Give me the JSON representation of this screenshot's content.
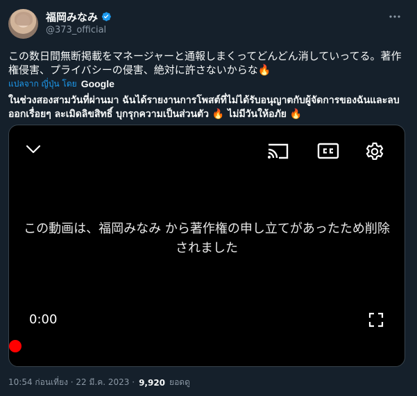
{
  "author": {
    "display_name": "福岡みなみ",
    "handle": "@373_official"
  },
  "tweet": {
    "text": "この数日間無断掲載をマネージャーと通報しまくってどんどん消していってる。著作権侵害、プライバシーの侵害、絶対に許さないからな🔥",
    "translate_label": "แปลจาก ญี่ปุ่น โดย",
    "translate_provider": "Google",
    "translated_text": "ในช่วงสองสามวันที่ผ่านมา ฉันได้รายงานการโพสต์ที่ไม่ได้รับอนุญาตกับผู้จัดการของฉันและลบออกเรื่อยๆ ละเมิดลิขสิทธิ์ บุกรุกความเป็นส่วนตัว 🔥 ไม่มีวันให้อภัย 🔥"
  },
  "video": {
    "removed_message": "この動画は、福岡みなみ から著作権の申し立てがあったため削除されました",
    "current_time": "0:00",
    "progress": 0
  },
  "meta": {
    "timestamp": "10:54 ก่อนเที่ยง · 22 มี.ค. 2023 ·",
    "views_count": "9,920",
    "views_label": "ยอดดู"
  },
  "colors": {
    "background": "#15202b",
    "accent": "#1d9bf0",
    "secondary_text": "#8b98a5",
    "progress": "#ff0000"
  },
  "icons": [
    "verified-badge-icon",
    "more-icon",
    "chevron-down-icon",
    "cast-icon",
    "closed-captions-icon",
    "gear-icon",
    "fullscreen-icon"
  ]
}
